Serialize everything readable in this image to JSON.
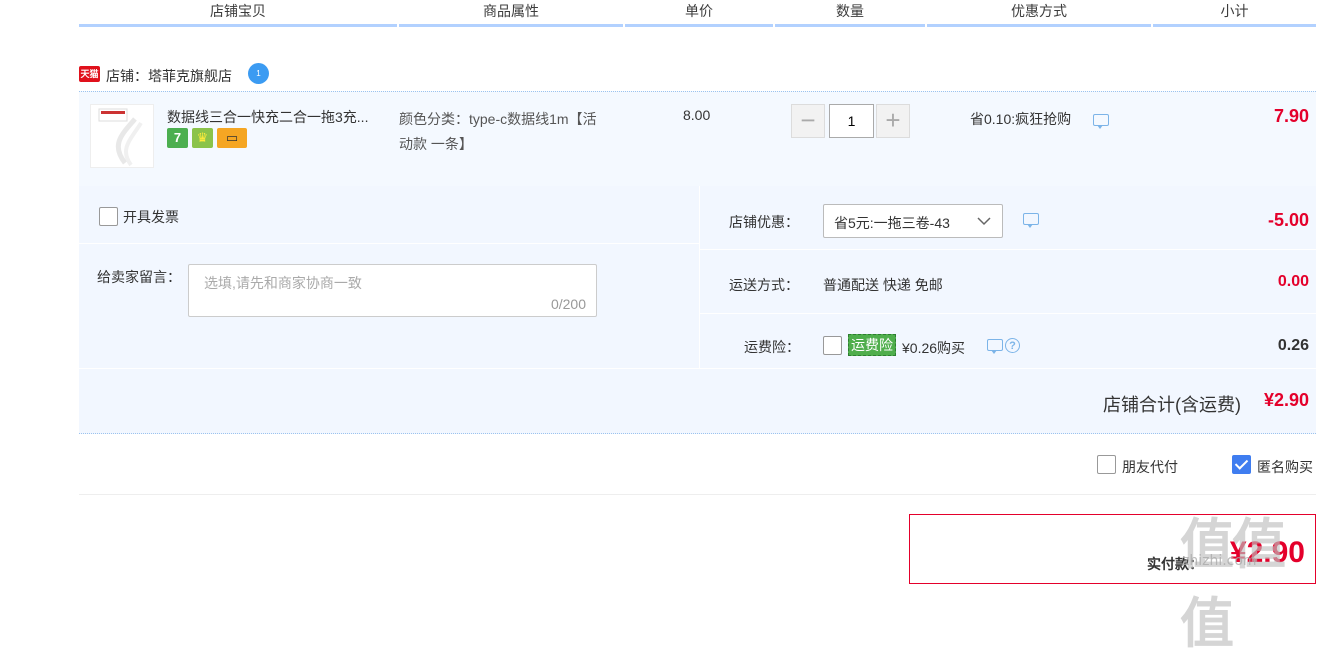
{
  "header": {
    "columns": [
      "店铺宝贝",
      "商品属性",
      "单价",
      "数量",
      "优惠方式",
      "小计"
    ]
  },
  "shop": {
    "tmall_badge": "天猫",
    "name": "店铺：塔菲克旗舰店",
    "wangwang_badge": "1"
  },
  "item": {
    "title": "数据线三合一快充二合一拖3充...",
    "attr_line1": "颜色分类：type-c数据线1m【活",
    "attr_line2": "动款 一条】",
    "price": "8.00",
    "quantity": "1",
    "discount": "省0.10:疯狂抢购",
    "subtotal": "7.90",
    "badges": [
      "7",
      "♛",
      "▭"
    ]
  },
  "invoice": {
    "label": "开具发票"
  },
  "message": {
    "label": "给卖家留言：",
    "placeholder": "选填,请先和商家协商一致",
    "counter": "0/200"
  },
  "shop_discount": {
    "label": "店铺优惠：",
    "selected": "省5元:一拖三卷-43",
    "amount": "-5.00"
  },
  "shipping": {
    "label": "运送方式：",
    "value": "普通配送 快递 免邮",
    "amount": "0.00"
  },
  "insurance": {
    "label": "运费险：",
    "tag": "运费险",
    "price_text": "¥0.26购买",
    "amount": "0.26"
  },
  "shop_total": {
    "label": "店铺合计(含运费)",
    "amount": "¥2.90"
  },
  "options": {
    "friend_pay": "朋友代付",
    "anonymous": "匿名购买"
  },
  "pay": {
    "label": "实付款：",
    "amount": "¥2.90"
  },
  "watermark": {
    "main": "值值值",
    "sub": "zhizhi.com"
  },
  "colors": {
    "accent_red": "#e4002b",
    "header_border": "#b2d1ff",
    "panel_bg": "#f2f7ff",
    "checkbox_on": "#3f7df0"
  }
}
